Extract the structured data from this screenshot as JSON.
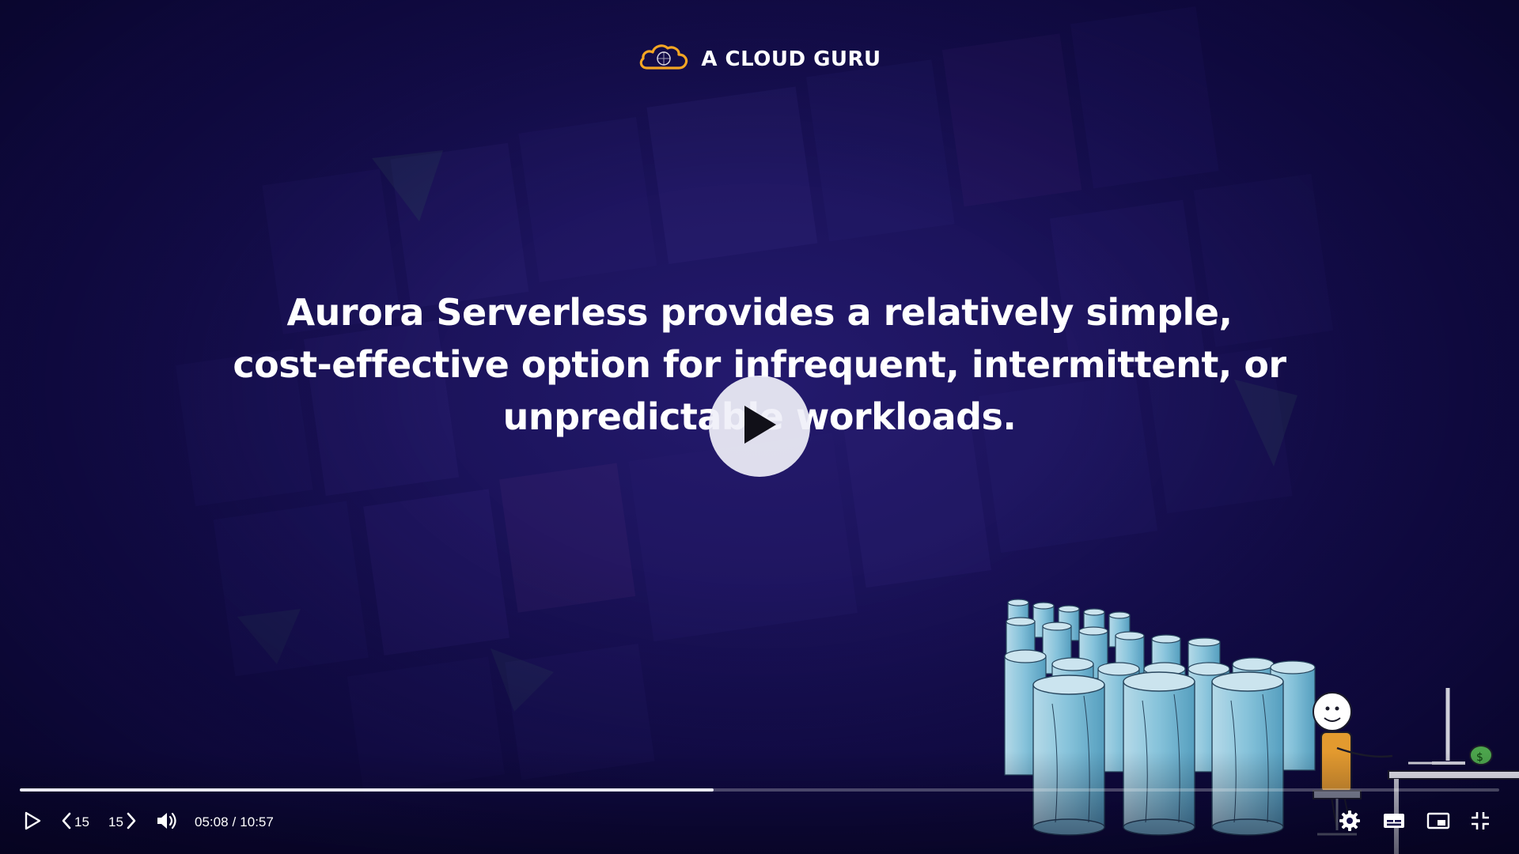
{
  "brand": {
    "name": "A CLOUD GURU"
  },
  "slide": {
    "lines": [
      "Aurora Serverless provides a relatively simple,",
      "cost-effective option for infrequent, intermittent, or",
      "unpredictable workloads."
    ]
  },
  "player": {
    "progress": 0.469,
    "current_time": "05:08",
    "time_separator": "/",
    "duration": "10:57",
    "skip_back_label": "15",
    "skip_forward_label": "15"
  },
  "colors": {
    "background": "#120c47",
    "accent_orange": "#f5a623",
    "text": "#ffffff"
  },
  "icons": {
    "logo": "cloud-logo-icon",
    "play": "play-icon",
    "skip_back": "chevron-left-icon",
    "skip_forward": "chevron-right-icon",
    "volume": "volume-icon",
    "settings": "gear-icon",
    "captions": "captions-icon",
    "pip": "picture-in-picture-icon",
    "fullscreen": "exit-fullscreen-icon"
  }
}
